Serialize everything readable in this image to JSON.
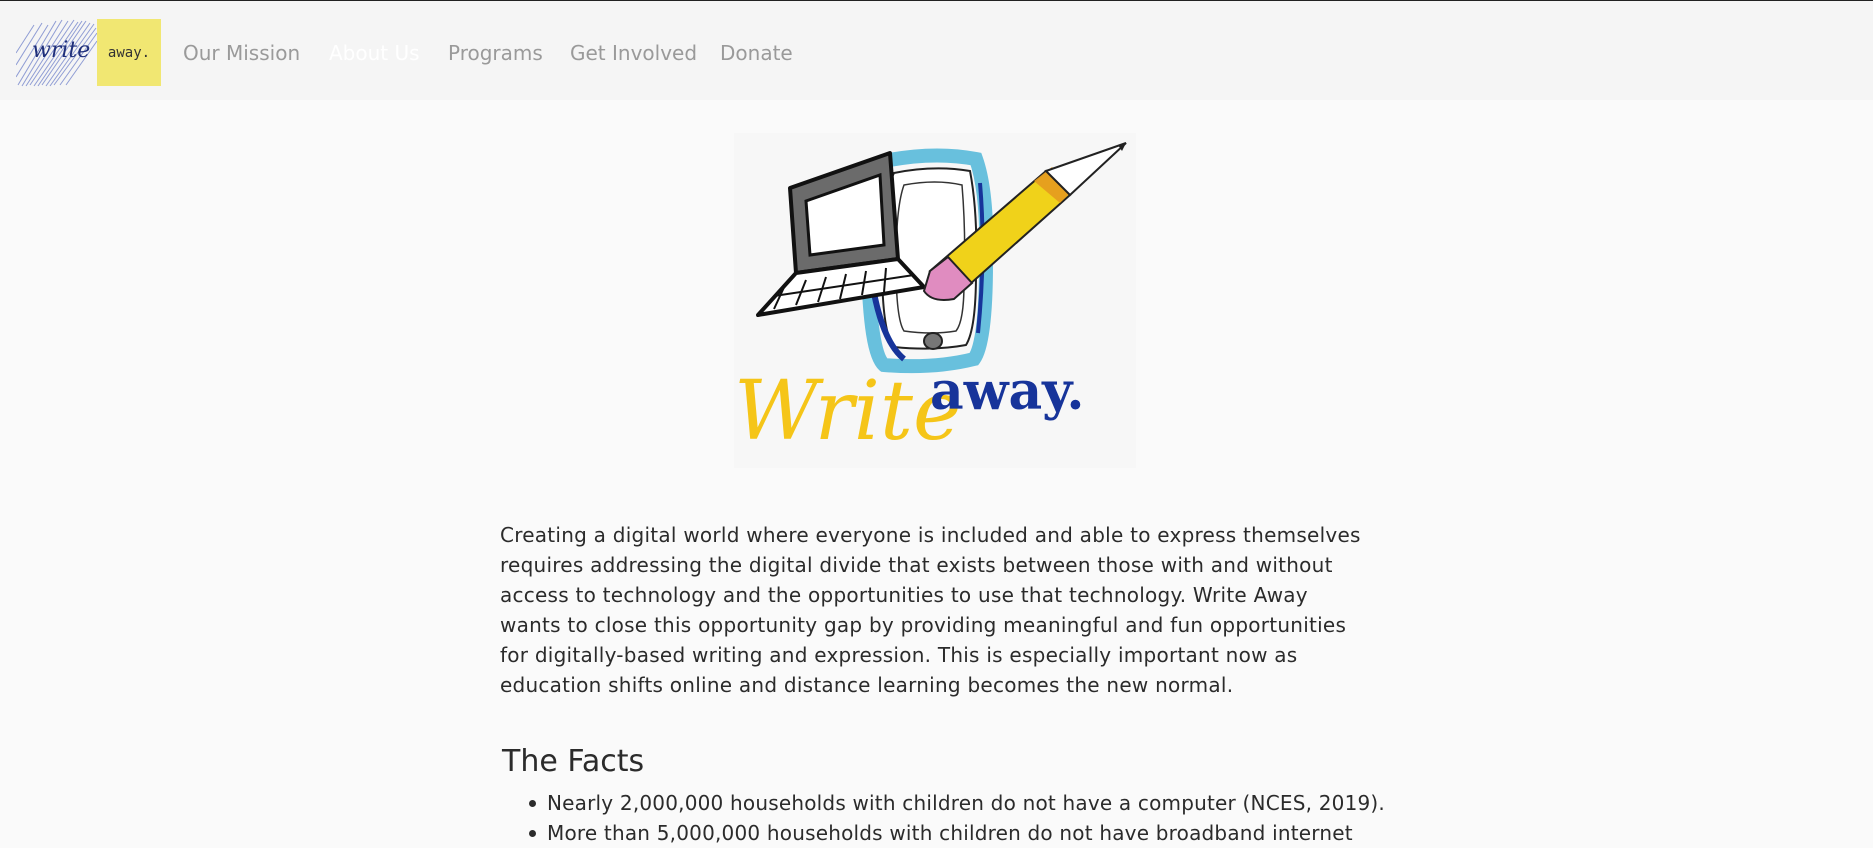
{
  "brand": {
    "sketch_text": "write",
    "box_text": "away.",
    "box_color": "#f1e772"
  },
  "nav": {
    "items": [
      {
        "label": "Our Mission",
        "active": false
      },
      {
        "label": "About Us",
        "active": true
      },
      {
        "label": "Programs",
        "active": false
      },
      {
        "label": "Get Involved",
        "active": false
      },
      {
        "label": "Donate",
        "active": false
      }
    ]
  },
  "hero": {
    "logo_word_1": "Write",
    "logo_word_2": "away.",
    "colors": {
      "yellow": "#f5c518",
      "blue": "#17349a",
      "light_blue": "#4fb6d8",
      "pink": "#e08cc0"
    }
  },
  "about": {
    "paragraph": "Creating a digital world where everyone is included and able to express themselves requires addressing the digital divide that exists between those with and without access to technology and the opportunities to use that technology. Write Away wants to close this opportunity gap by providing meaningful and fun opportunities for digitally-based writing and expression. This is especially important now as education shifts online and distance learning becomes the new normal."
  },
  "facts": {
    "title": "The Facts",
    "items": [
      "Nearly 2,000,000 households with children do not have a computer (NCES, 2019).",
      "More than 5,000,000 households with children do not have broadband internet"
    ]
  }
}
